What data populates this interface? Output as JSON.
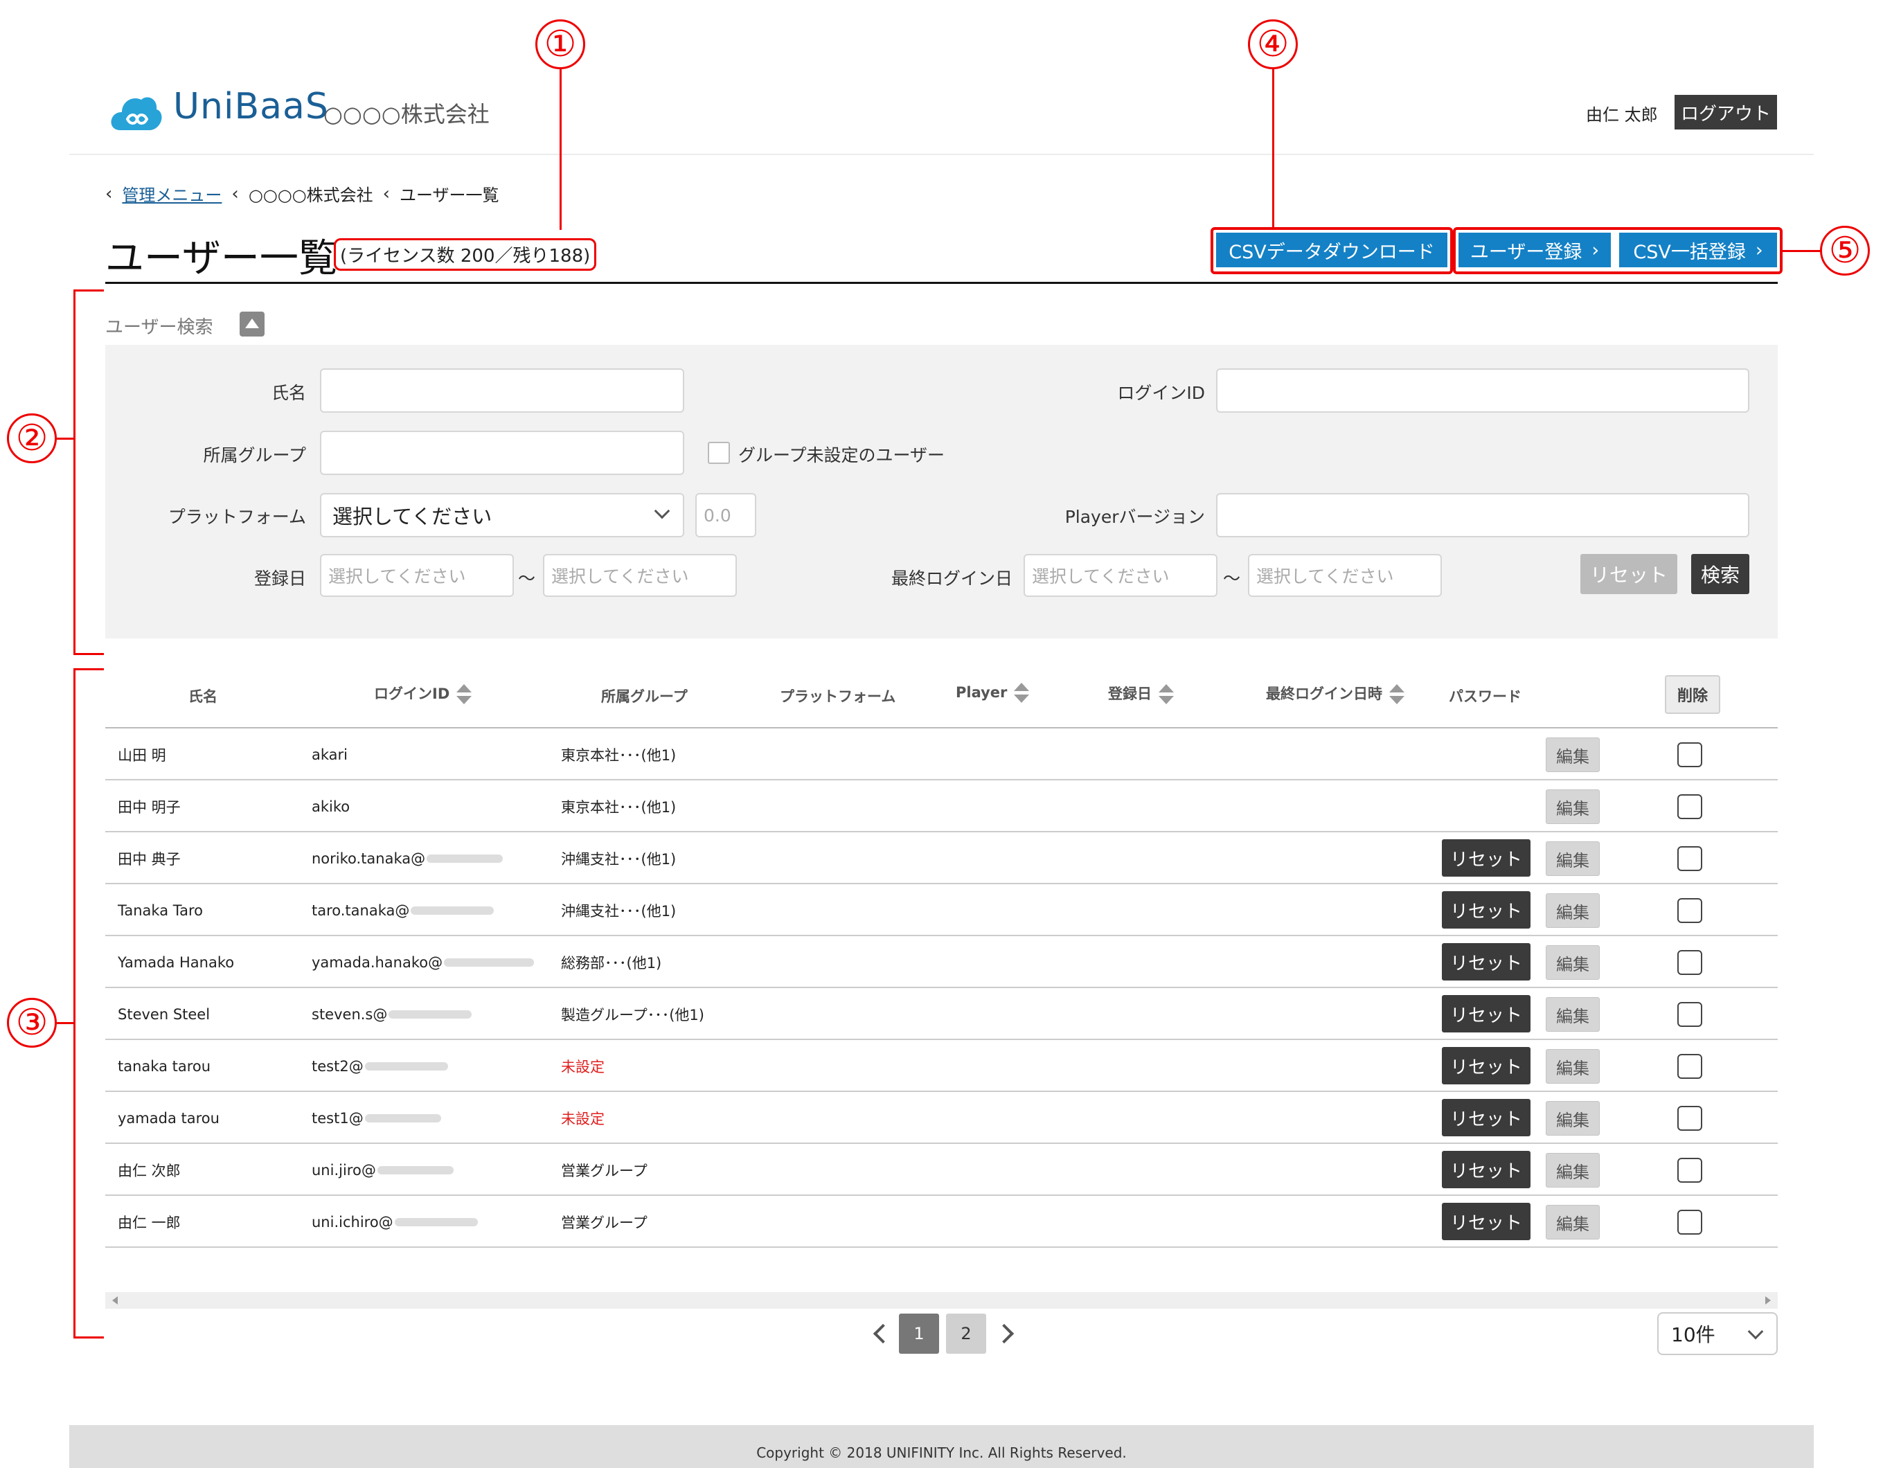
{
  "header": {
    "brand": "UniBaaS",
    "company": "○○○○株式会社",
    "user_name": "由仁 太郎",
    "logout_label": "ログアウト"
  },
  "breadcrumb": {
    "items": [
      "管理メニュー",
      "○○○○株式会社",
      "ユーザー一覧"
    ]
  },
  "page": {
    "title": "ユーザー一覧",
    "license_info": "(ライセンス数 200／残り188)"
  },
  "actions": {
    "csv_download": "CSVデータダウンロード",
    "user_register": "ユーザー登録",
    "csv_bulk_register": "CSV一括登録"
  },
  "callouts": [
    "①",
    "②",
    "③",
    "④",
    "⑤"
  ],
  "search": {
    "heading": "ユーザー検索",
    "name_label": "氏名",
    "login_id_label": "ログインID",
    "group_label": "所属グループ",
    "no_group_checkbox_label": "グループ未設定のユーザー",
    "platform_label": "プラットフォーム",
    "platform_selected": "選択してください",
    "version_placeholder": "0.0",
    "player_version_label": "Playerバージョン",
    "registered_label": "登録日",
    "last_login_label": "最終ログイン日",
    "date_placeholder": "選択してください",
    "range_sep": "～",
    "reset_label": "リセット",
    "search_label": "検索"
  },
  "table": {
    "headers": [
      "氏名",
      "ログインID",
      "所属グループ",
      "プラットフォーム",
      "Player",
      "登録日",
      "最終ログイン日時",
      "パスワード"
    ],
    "delete_label": "削除",
    "reset_label": "リセット",
    "edit_label": "編集",
    "rows": [
      {
        "name": "山田 明",
        "login_id": "akari",
        "group": "東京本社･･･(他1)",
        "has_reset": false,
        "unset": false
      },
      {
        "name": "田中 明子",
        "login_id": "akiko",
        "group": "東京本社･･･(他1)",
        "has_reset": false,
        "unset": false
      },
      {
        "name": "田中 典子",
        "login_id": "noriko.tanaka@",
        "group": "沖縄支社･･･(他1)",
        "has_reset": true,
        "unset": false
      },
      {
        "name": "Tanaka Taro",
        "login_id": "taro.tanaka@",
        "group": "沖縄支社･･･(他1)",
        "has_reset": true,
        "unset": false
      },
      {
        "name": "Yamada Hanako",
        "login_id": "yamada.hanako@",
        "group": "総務部･･･(他1)",
        "has_reset": true,
        "unset": false
      },
      {
        "name": "Steven Steel",
        "login_id": "steven.s@",
        "group": "製造グループ･･･(他1)",
        "has_reset": true,
        "unset": false
      },
      {
        "name": "tanaka tarou",
        "login_id": "test2@",
        "group": "未設定",
        "has_reset": true,
        "unset": true
      },
      {
        "name": "yamada tarou",
        "login_id": "test1@",
        "group": "未設定",
        "has_reset": true,
        "unset": true
      },
      {
        "name": "由仁 次郎",
        "login_id": "uni.jiro@",
        "group": "営業グループ",
        "has_reset": true,
        "unset": false
      },
      {
        "name": "由仁 一郎",
        "login_id": "uni.ichiro@",
        "group": "営業グループ",
        "has_reset": true,
        "unset": false
      }
    ]
  },
  "pagination": {
    "pages": [
      "1",
      "2"
    ],
    "current": "1",
    "per_page": "10件"
  },
  "footer": {
    "copyright": "Copyright © 2018 UNIFINITY Inc. All Rights Reserved."
  },
  "colors": {
    "brand": "#1a5f96",
    "primary_button": "#1481c6",
    "dark_button": "#3b3b3b",
    "annotation": "#e00000",
    "unset_text": "#e02020"
  }
}
